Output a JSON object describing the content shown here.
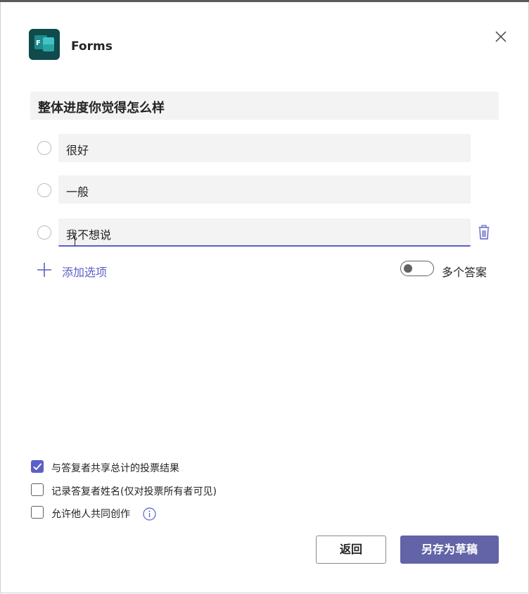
{
  "header": {
    "app_name": "Forms",
    "app_icon": "forms-icon",
    "icon_letter": "F",
    "close_icon": "close-icon"
  },
  "poll": {
    "question": "整体进度你觉得怎么样",
    "options": [
      {
        "label": "很好"
      },
      {
        "label": "一般"
      },
      {
        "label": "我不想说"
      }
    ],
    "add_option_label": "添加选项",
    "multiple_answers_label": "多个答案",
    "multiple_answers_enabled": false
  },
  "settings": [
    {
      "label": "与答复者共享总计的投票结果",
      "checked": true
    },
    {
      "label": "记录答复者姓名(仅对投票所有者可见)",
      "checked": false
    },
    {
      "label": "允许他人共同创作",
      "checked": false
    }
  ],
  "footer": {
    "back_label": "返回",
    "save_draft_label": "另存为草稿"
  },
  "colors": {
    "accent": "#5b5fc7",
    "primary_button": "#6264a7",
    "app_icon_bg": "#0f4a4c",
    "field_bg": "#f3f3f3"
  }
}
